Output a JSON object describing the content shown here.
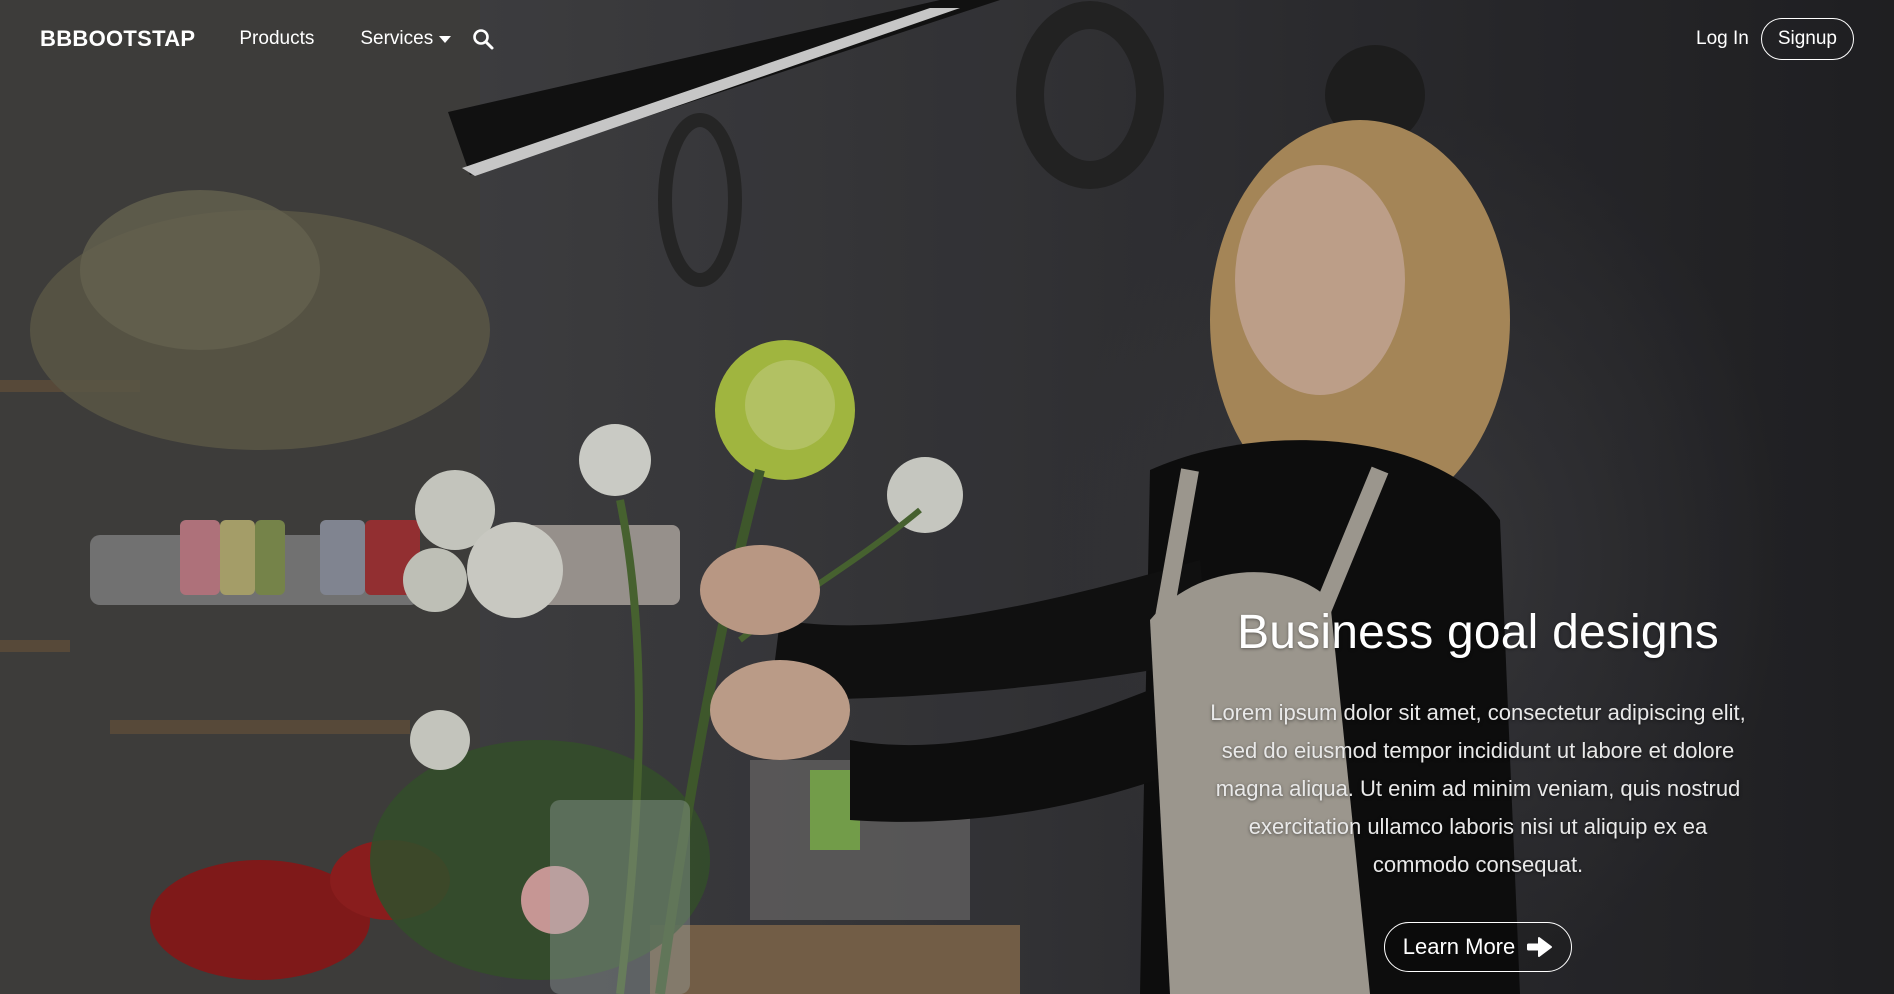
{
  "nav": {
    "brand": "BBBOOTSTAP",
    "links": [
      {
        "label": "Products"
      },
      {
        "label": "Services",
        "has_dropdown": true
      }
    ],
    "search_icon": "search-icon",
    "login_label": "Log In",
    "signup_label": "Signup"
  },
  "hero": {
    "headline": "Business goal designs",
    "body": "Lorem ipsum dolor sit amet, consectetur adipiscing elit, sed do eiusmod tempor incididunt ut labore et dolore magna aliqua. Ut enim ad minim veniam, quis nostrud exercitation ullamco laboris nisi ut aliquip ex ea commodo consequat.",
    "cta_label": "Learn More",
    "cta_icon": "arrow-right-icon"
  },
  "colors": {
    "text": "#ffffff",
    "background": "#2b2b2d"
  }
}
